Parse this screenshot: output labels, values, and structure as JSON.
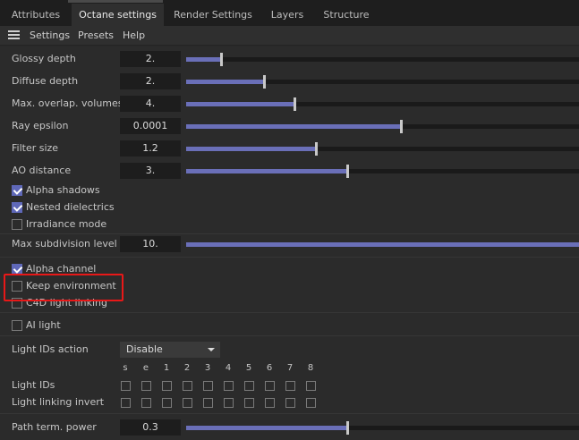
{
  "tabs": [
    "Attributes",
    "Octane settings",
    "Render Settings",
    "Layers",
    "Structure"
  ],
  "menu": [
    "Settings",
    "Presets",
    "Help"
  ],
  "sliders": [
    {
      "label": "Glossy depth",
      "value": "2.",
      "fraction": 0.089
    },
    {
      "label": "Diffuse depth",
      "value": "2.",
      "fraction": 0.198
    },
    {
      "label": "Max. overlap. volumes",
      "value": "4.",
      "fraction": 0.275
    },
    {
      "label": "Ray epsilon",
      "value": "0.0001",
      "fraction": 0.546
    },
    {
      "label": "Filter size",
      "value": "1.2",
      "fraction": 0.33
    },
    {
      "label": "AO distance",
      "value": "3.",
      "fraction": 0.41
    }
  ],
  "checkboxes_group1": [
    {
      "label": "Alpha shadows",
      "checked": true
    },
    {
      "label": "Nested dielectrics",
      "checked": true
    },
    {
      "label": "Irradiance mode",
      "checked": false
    }
  ],
  "subdivision": {
    "label": "Max subdivision level",
    "value": "10.",
    "fraction": 1.0
  },
  "checkboxes_group2": [
    {
      "label": "Alpha channel",
      "checked": true
    },
    {
      "label": "Keep environment",
      "checked": false
    },
    {
      "label": "C4D light linking",
      "checked": false
    }
  ],
  "ai_light": {
    "label": "AI light",
    "checked": false
  },
  "light_ids_action": {
    "label": "Light IDs action",
    "value": "Disable"
  },
  "channels": [
    "s",
    "e",
    "1",
    "2",
    "3",
    "4",
    "5",
    "6",
    "7",
    "8"
  ],
  "light_ids": {
    "label": "Light IDs"
  },
  "light_linking_invert": {
    "label": "Light linking invert"
  },
  "path_term": {
    "label": "Path term. power",
    "value": "0.3",
    "fraction": 0.411
  },
  "colors": {
    "accent": "#6a6fb8",
    "checkbox": "#5f68b8",
    "highlight": "#e81818"
  }
}
